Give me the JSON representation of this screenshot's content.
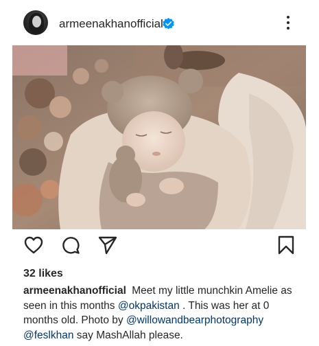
{
  "post": {
    "username": "armeenakhanofficial",
    "likes": "32 likes",
    "caption": {
      "username": "armeenakhanofficial",
      "part1": "Meet my little munchkin Amelie as seen in this months",
      "mention1": "@okpakistan",
      "part2": ". This was her at 0 months old. Photo by",
      "mention2": "@willowandbearphotography",
      "mention3": "@feslkhan",
      "part3": "say MashAllah please."
    }
  },
  "icons": {
    "verified": "verified-badge-icon",
    "more": "more-options-icon",
    "like": "heart-icon",
    "comment": "comment-icon",
    "share": "send-icon",
    "save": "bookmark-icon"
  },
  "colors": {
    "accent": "#0095f6",
    "text": "#262626",
    "mention": "#00376b"
  }
}
